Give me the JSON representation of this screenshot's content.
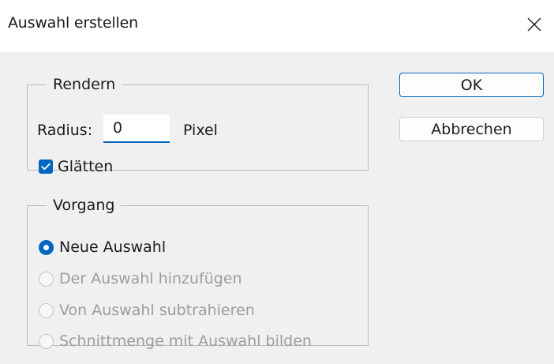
{
  "window": {
    "title": "Auswahl erstellen",
    "close_icon": "close-icon"
  },
  "render_group": {
    "legend": "Rendern",
    "radius_label": "Radius:",
    "radius_value": "0",
    "unit_label": "Pixel",
    "smooth_label": "Glätten",
    "smooth_checked": true
  },
  "operation_group": {
    "legend": "Vorgang",
    "options": [
      {
        "label": "Neue Auswahl",
        "selected": true,
        "enabled": true
      },
      {
        "label": "Der Auswahl hinzufügen",
        "selected": false,
        "enabled": false
      },
      {
        "label": "Von Auswahl subtrahieren",
        "selected": false,
        "enabled": false
      },
      {
        "label": "Schnittmenge mit Auswahl bilden",
        "selected": false,
        "enabled": false
      }
    ]
  },
  "buttons": {
    "ok": "OK",
    "cancel": "Abbrechen"
  },
  "colors": {
    "accent": "#0067c0",
    "background": "#f0f0f0",
    "disabled_text": "#9d9d9d"
  }
}
